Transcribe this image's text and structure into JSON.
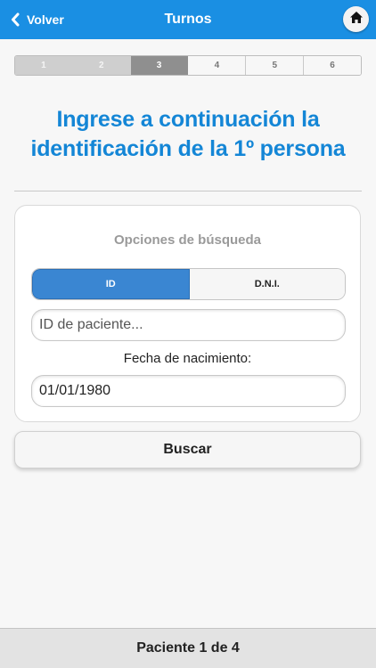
{
  "header": {
    "back_label": "Volver",
    "title": "Turnos",
    "back_icon": "chevron-left-icon",
    "home_icon": "home-icon",
    "accent_color": "#1a8fe3"
  },
  "steps": [
    {
      "label": "1",
      "state": "done"
    },
    {
      "label": "2",
      "state": "done"
    },
    {
      "label": "3",
      "state": "current"
    },
    {
      "label": "4",
      "state": "todo"
    },
    {
      "label": "5",
      "state": "todo"
    },
    {
      "label": "6",
      "state": "todo"
    }
  ],
  "main": {
    "heading_line1": "Ingrese a continuación la",
    "heading_line2": "identificación de la 1º persona",
    "heading_color": "#1486d6"
  },
  "search_options": {
    "label": "Opciones de búsqueda",
    "options": [
      "ID",
      "D.N.I."
    ],
    "selected": "ID",
    "id_placeholder": "ID de paciente...",
    "id_value": "",
    "dob_label": "Fecha de nacimiento:",
    "dob_value": "01/01/1980"
  },
  "search_button_label": "Buscar",
  "footer": {
    "status": "Paciente 1 de 4"
  }
}
